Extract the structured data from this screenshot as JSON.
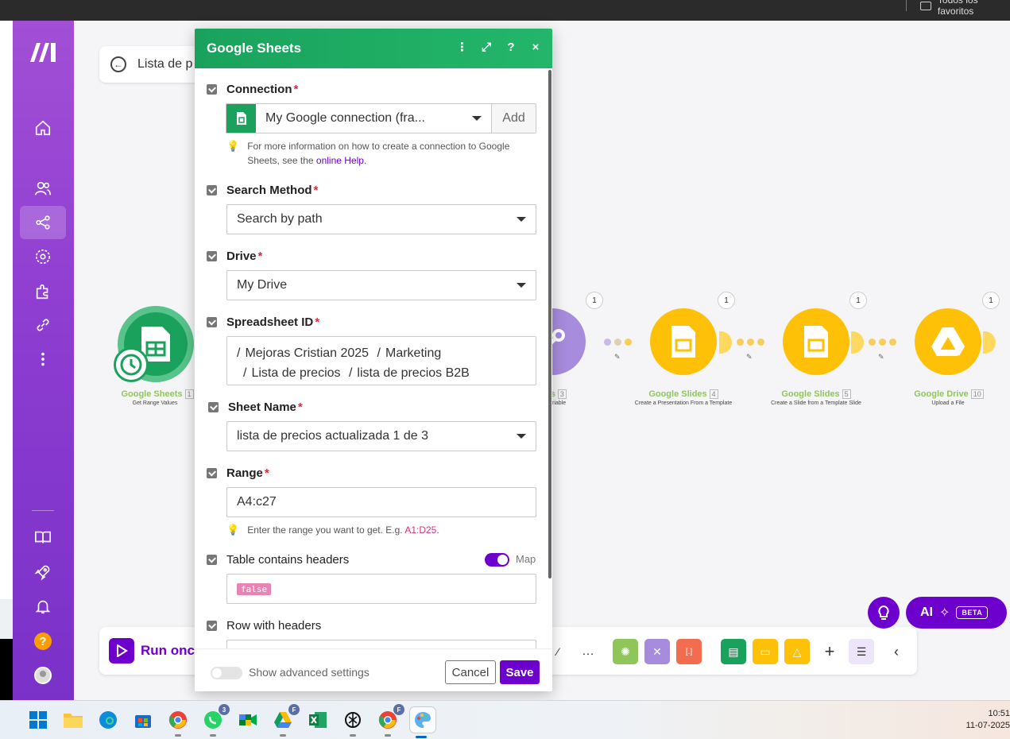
{
  "browser": {
    "bookmark_folder": "Todos los favoritos"
  },
  "sidebar": {
    "items": [
      {
        "name": "home-icon"
      },
      {
        "name": "team-icon"
      },
      {
        "name": "scenarios-icon"
      },
      {
        "name": "templates-icon"
      },
      {
        "name": "apps-icon"
      },
      {
        "name": "connections-icon"
      },
      {
        "name": "more-icon"
      }
    ],
    "bottom": [
      {
        "name": "docs-icon"
      },
      {
        "name": "rocket-icon"
      },
      {
        "name": "bell-icon"
      },
      {
        "name": "help-icon",
        "label": "?"
      },
      {
        "name": "avatar"
      }
    ]
  },
  "canvas": {
    "scenario_name": "Lista de p",
    "nodes": [
      {
        "title": "Google Sheets",
        "num": "1",
        "sub": "Get Range Values",
        "color": "#1aa25c"
      },
      {
        "title": "ols",
        "num": "3",
        "sub": "riable",
        "color": "#a78bdc"
      },
      {
        "title": "Google Slides",
        "num": "4",
        "sub": "Create a Presentation From a Template",
        "badge": "1",
        "color": "#ffc107"
      },
      {
        "title": "Google Slides",
        "num": "5",
        "sub": "Create a Slide from a Template Slide",
        "badge": "1",
        "color": "#ffc107"
      },
      {
        "title": "Google Drive",
        "num": "10",
        "sub": "Upload a File",
        "badge": "1",
        "color": "#ffc107"
      }
    ],
    "tools_badge": "1"
  },
  "toolbar": {
    "run_label": "Run once",
    "more": "…",
    "add": "+"
  },
  "ai": {
    "label": "AI",
    "beta": "BETA"
  },
  "modal": {
    "title": "Google Sheets",
    "icons": [
      "more-vert-icon",
      "expand-icon",
      "help-icon",
      "close-icon"
    ],
    "help_glyph": "?",
    "close_glyph": "×",
    "connection": {
      "label": "Connection",
      "value": "My Google connection (fra...",
      "add": "Add",
      "hint_prefix": "For more information on how to create a connection to Google",
      "hint_line2_prefix": "Sheets, see the ",
      "hint_link": "online Help",
      "hint_suffix": "."
    },
    "search_method": {
      "label": "Search Method",
      "value": "Search by path"
    },
    "drive": {
      "label": "Drive",
      "value": "My Drive"
    },
    "spreadsheet": {
      "label": "Spreadsheet ID",
      "path": [
        "Mejoras Cristian 2025",
        "Marketing",
        "Lista de precios",
        "lista de precios B2B"
      ]
    },
    "sheet_name": {
      "label": "Sheet Name",
      "value": "lista de precios actualizada 1 de 3"
    },
    "range": {
      "label": "Range",
      "value": "A4:c27",
      "hint_prefix": "Enter the range you want to get. E.g. ",
      "hint_example": "A1:D25",
      "hint_suffix": "."
    },
    "headers": {
      "label": "Table contains headers",
      "map": "Map",
      "value": "false"
    },
    "row_headers": {
      "label": "Row with headers"
    },
    "footer": {
      "advanced": "Show advanced settings",
      "cancel": "Cancel",
      "save": "Save"
    },
    "required_mark": "*"
  },
  "taskbar": {
    "whatsapp_badge": "3",
    "drive_badge": "F",
    "chrome2_badge": "F",
    "time": "10:51",
    "date": "11-07-2025"
  }
}
